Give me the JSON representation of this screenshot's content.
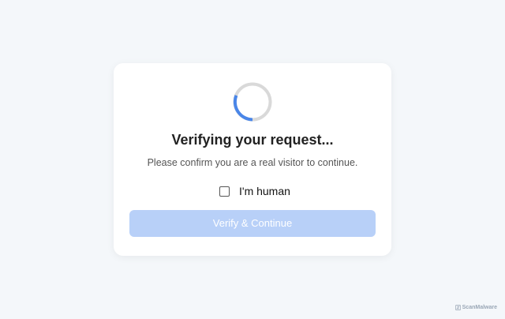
{
  "card": {
    "title": "Verifying your request...",
    "subtitle": "Please confirm you are a real visitor to continue.",
    "checkbox_label": "I'm human",
    "checkbox_checked": false,
    "button_label": "Verify & Continue"
  },
  "brand": {
    "name": "ScanMalware",
    "icon": "scanmalware-logo-icon"
  },
  "colors": {
    "background": "#f4f7fa",
    "spinner_track": "#d9d9d9",
    "spinner_arc": "#4a86e8",
    "button_disabled": "#b8d0f8"
  }
}
